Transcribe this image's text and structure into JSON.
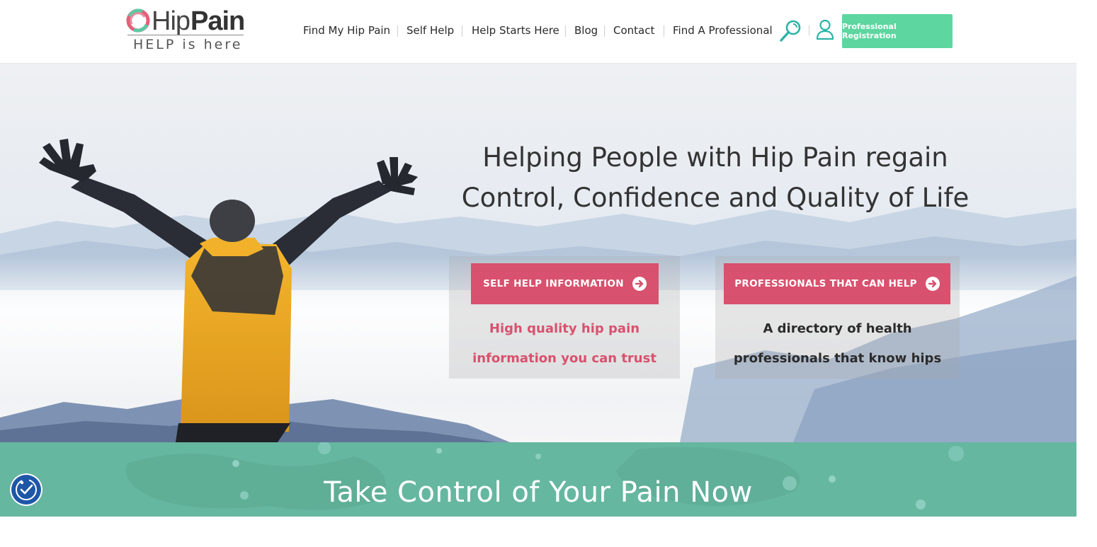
{
  "logo": {
    "hip": "Hip",
    "pain": "Pain",
    "tagline": "HELP is here"
  },
  "nav": {
    "items": [
      {
        "label": "Find My Hip Pain"
      },
      {
        "label": "Self Help"
      },
      {
        "label": "Help Starts Here"
      },
      {
        "label": "Blog"
      },
      {
        "label": "Contact"
      },
      {
        "label": "Find A Professional"
      }
    ],
    "search_icon": "magnifier-icon",
    "user_icon": "user-icon",
    "registration_label": "Professional Registration"
  },
  "hero": {
    "title_line1": "Helping People with Hip Pain regain",
    "title_line2": "Control, Confidence and Quality of Life",
    "cards": [
      {
        "button_label": "SELF HELP INFORMATION",
        "desc_line1": "High quality hip pain",
        "desc_line2": "information you can trust"
      },
      {
        "button_label": "PROFESSIONALS THAT CAN HELP",
        "desc_line1": "A directory of health",
        "desc_line2": "professionals that know hips"
      }
    ]
  },
  "band": {
    "title": "Take Control of Your Pain Now"
  },
  "colors": {
    "accent_pink": "#d8516e",
    "accent_green": "#5dd6a0",
    "band_green": "#66b7a0",
    "teal_icons": "#2bb3a6",
    "accessibility_blue": "#1e57a8"
  },
  "accessibility": {
    "icon": "accessibility-icon"
  }
}
